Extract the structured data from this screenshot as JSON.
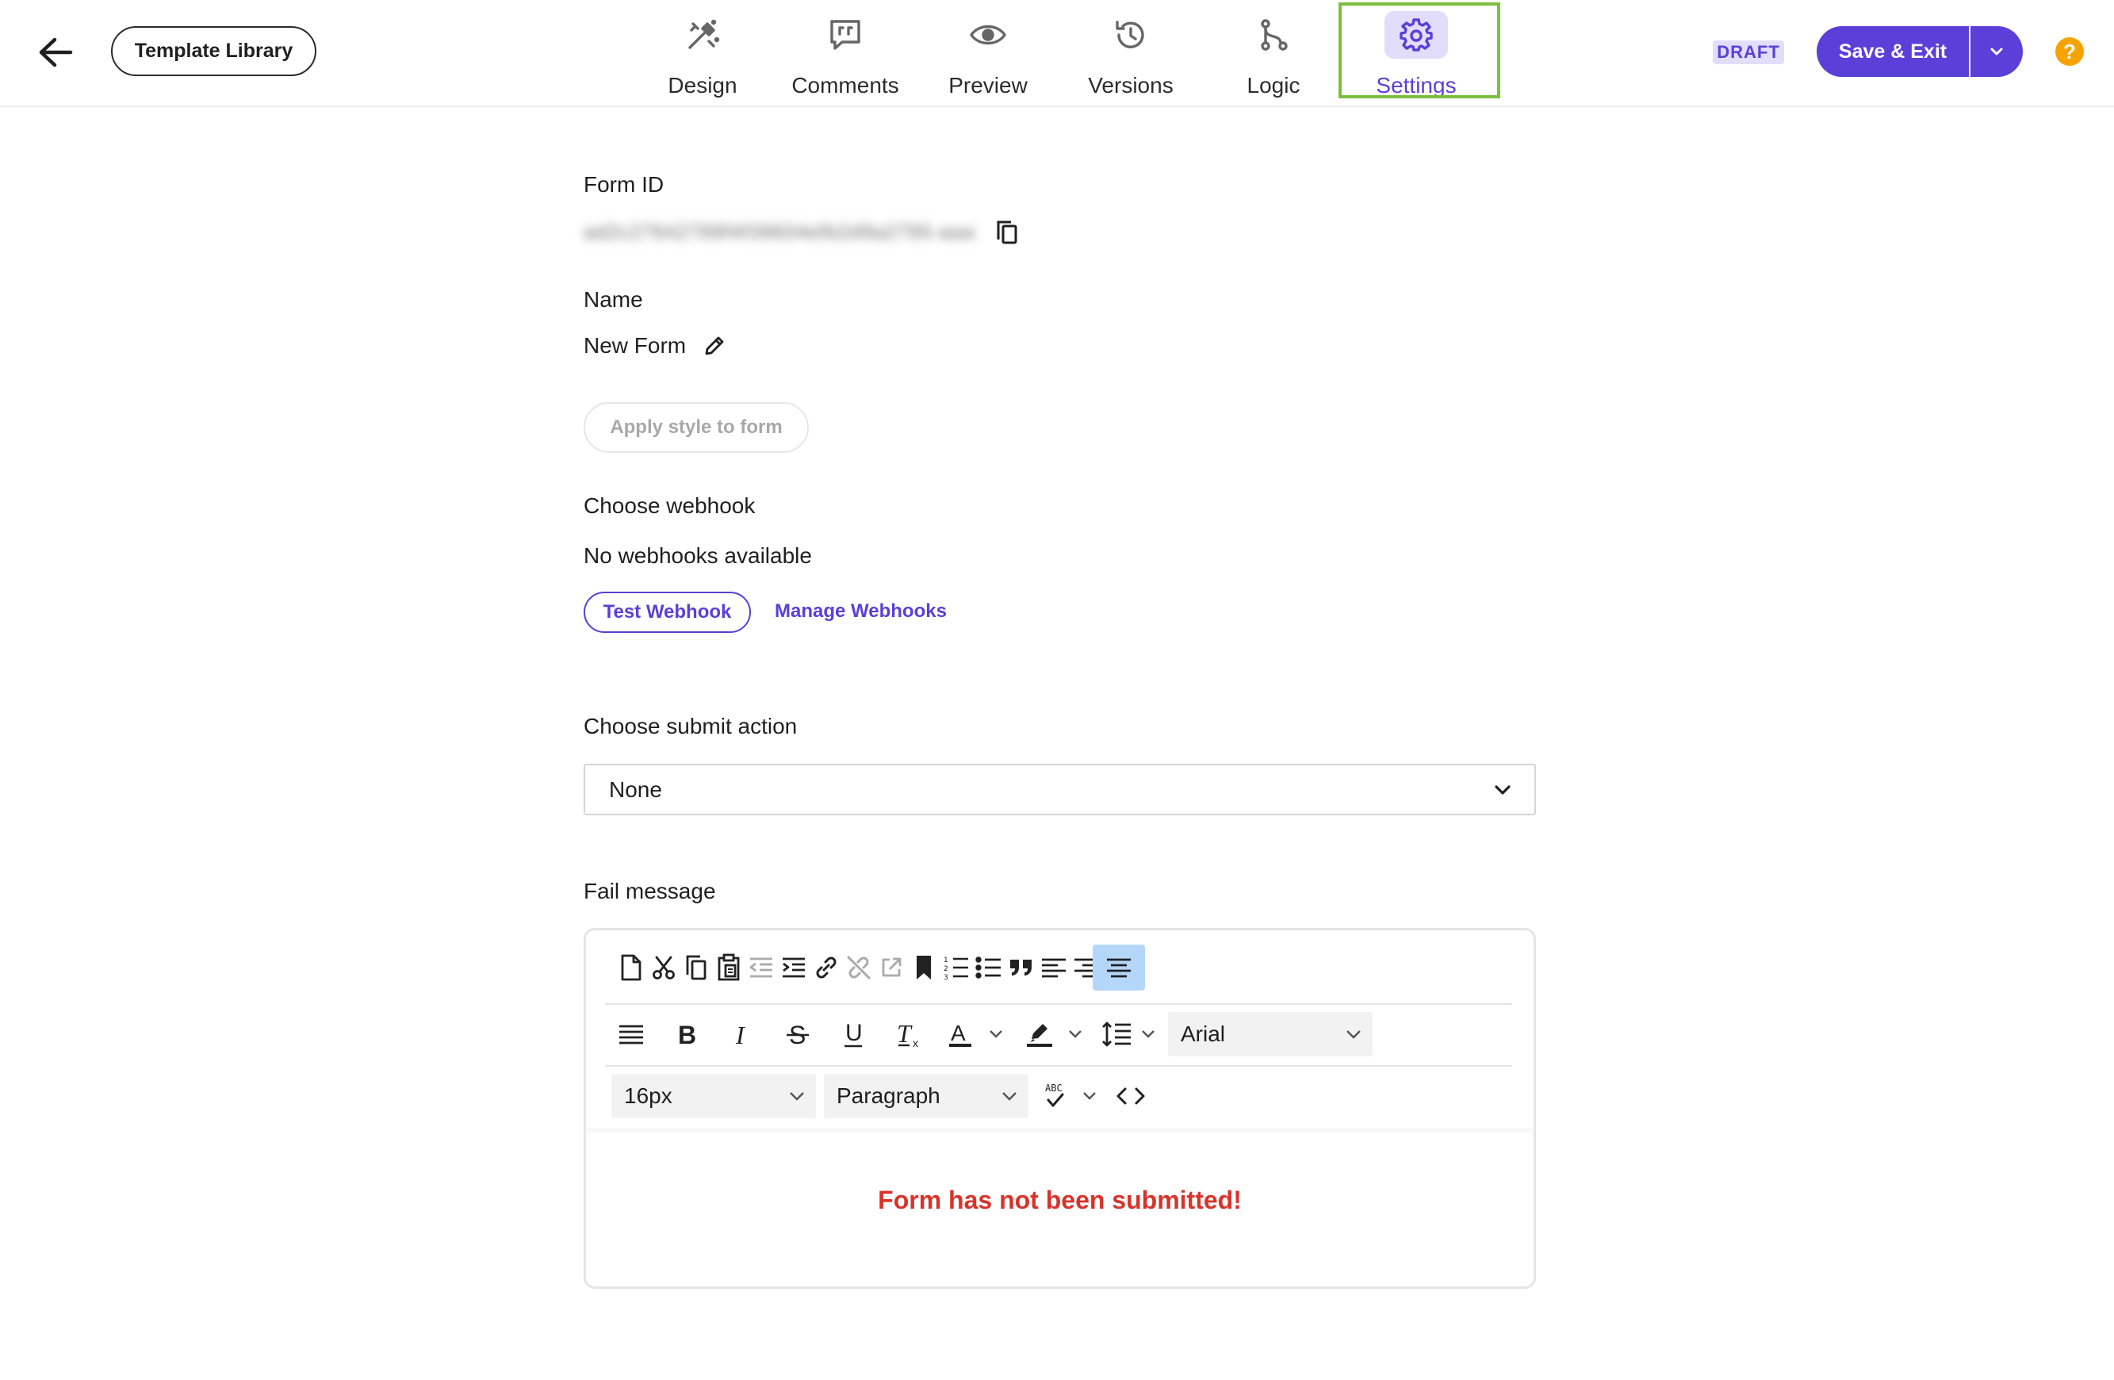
{
  "header": {
    "template_library_label": "Template Library",
    "tabs": [
      {
        "label": "Design",
        "icon": "design-icon"
      },
      {
        "label": "Comments",
        "icon": "comments-icon"
      },
      {
        "label": "Preview",
        "icon": "eye-icon"
      },
      {
        "label": "Versions",
        "icon": "history-icon"
      },
      {
        "label": "Logic",
        "icon": "logic-icon"
      },
      {
        "label": "Settings",
        "icon": "gear-icon",
        "active": true
      }
    ],
    "status_badge": "DRAFT",
    "save_label": "Save & Exit",
    "help_label": "?"
  },
  "settings": {
    "form_id_label": "Form ID",
    "form_id_value": "ad2c27642789f4f39604efb2d9a2795-aaa",
    "name_label": "Name",
    "name_value": "New Form",
    "apply_style_label": "Apply style to form",
    "webhook_label": "Choose webhook",
    "no_webhooks_text": "No webhooks available",
    "test_webhook_label": "Test Webhook",
    "manage_webhooks_label": "Manage Webhooks",
    "submit_action_label": "Choose submit action",
    "submit_action_value": "None",
    "fail_message_label": "Fail message"
  },
  "editor": {
    "font_family": "Arial",
    "font_size": "16px",
    "block_format": "Paragraph",
    "content_text": "Form has not been submitted!"
  },
  "colors": {
    "accent": "#5a3fd9",
    "accent_light": "#e2ddfb",
    "active_outline": "#7bbf3f",
    "error_text": "#d8332a",
    "help": "#f6a200"
  }
}
